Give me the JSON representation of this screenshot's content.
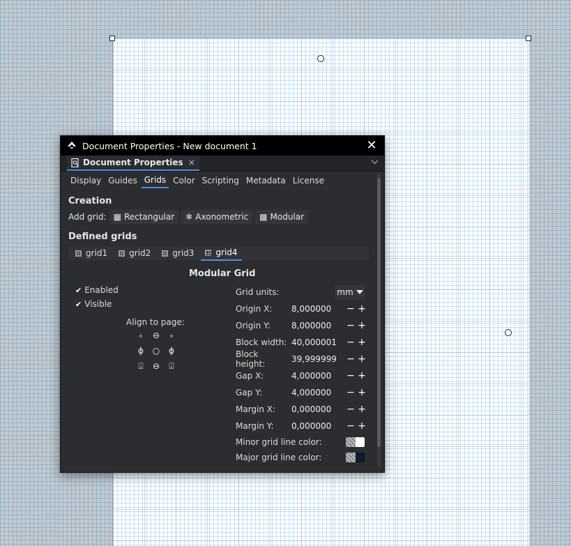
{
  "dialog": {
    "title": "Document Properties - New document 1",
    "close_glyph": "✕",
    "dock_tab_label": "Document Properties",
    "dock_tab_close": "×",
    "chevron_glyph": "⌄"
  },
  "subtabs": [
    "Display",
    "Guides",
    "Grids",
    "Color",
    "Scripting",
    "Metadata",
    "License"
  ],
  "active_subtab": "Grids",
  "creation": {
    "heading": "Creation",
    "add_grid_label": "Add grid:",
    "buttons": [
      {
        "label": "Rectangular",
        "icon": "rectangular-grid-icon"
      },
      {
        "label": "Axonometric",
        "icon": "axonometric-grid-icon"
      },
      {
        "label": "Modular",
        "icon": "modular-grid-icon"
      }
    ]
  },
  "defined_grids": {
    "heading": "Defined grids",
    "tabs": [
      "grid1",
      "grid2",
      "grid3",
      "grid4"
    ],
    "active": "grid4"
  },
  "modular": {
    "title": "Modular Grid",
    "enabled_label": "Enabled",
    "visible_label": "Visible",
    "align_label": "Align to page:",
    "grid_units_label": "Grid units:",
    "grid_units_value": "mm",
    "fields": [
      {
        "label": "Origin X:",
        "value": "8,000000"
      },
      {
        "label": "Origin Y:",
        "value": "8,000000"
      },
      {
        "label": "Block width:",
        "value": "40,000001"
      },
      {
        "label": "Block height:",
        "value": "39,999999"
      },
      {
        "label": "Gap X:",
        "value": "4,000000"
      },
      {
        "label": "Gap Y:",
        "value": "4,000000"
      },
      {
        "label": "Margin X:",
        "value": "0,000000"
      },
      {
        "label": "Margin Y:",
        "value": "0,000000"
      }
    ],
    "minor_color_label": "Minor grid line color:",
    "major_color_label": "Major grid line color:",
    "minor_color": "#ffffff",
    "major_color": "#0d1b2e",
    "minus_glyph": "−",
    "plus_glyph": "+"
  }
}
